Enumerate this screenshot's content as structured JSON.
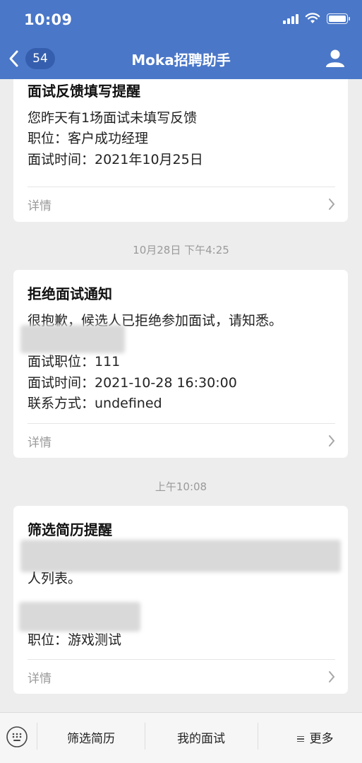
{
  "status_bar": {
    "time": "10:09"
  },
  "header": {
    "back_count": "54",
    "title": "Moka招聘助手"
  },
  "messages": [
    {
      "title": "面试反馈填写提醒",
      "lines": [
        "您昨天有1场面试未填写反馈",
        "职位：客户成功经理",
        "面试时间：2021年10月25日"
      ],
      "detail_label": "详情"
    },
    {
      "timestamp": "10月28日 下午4:25",
      "title": "拒绝面试通知",
      "lines": [
        "很抱歉，候选人已拒绝参加面试，请知悉。",
        "面试职位：111",
        "面试时间：2021-10-28 16:30:00",
        "联系方式：undefined"
      ],
      "detail_label": "详情"
    },
    {
      "timestamp": "上午10:08",
      "title": "筛选简历提醒",
      "lines": [
        "人列表。",
        "职位：游戏测试"
      ],
      "detail_label": "详情"
    }
  ],
  "bottom_menu": {
    "items": [
      "筛选简历",
      "我的面试",
      "更多"
    ]
  }
}
